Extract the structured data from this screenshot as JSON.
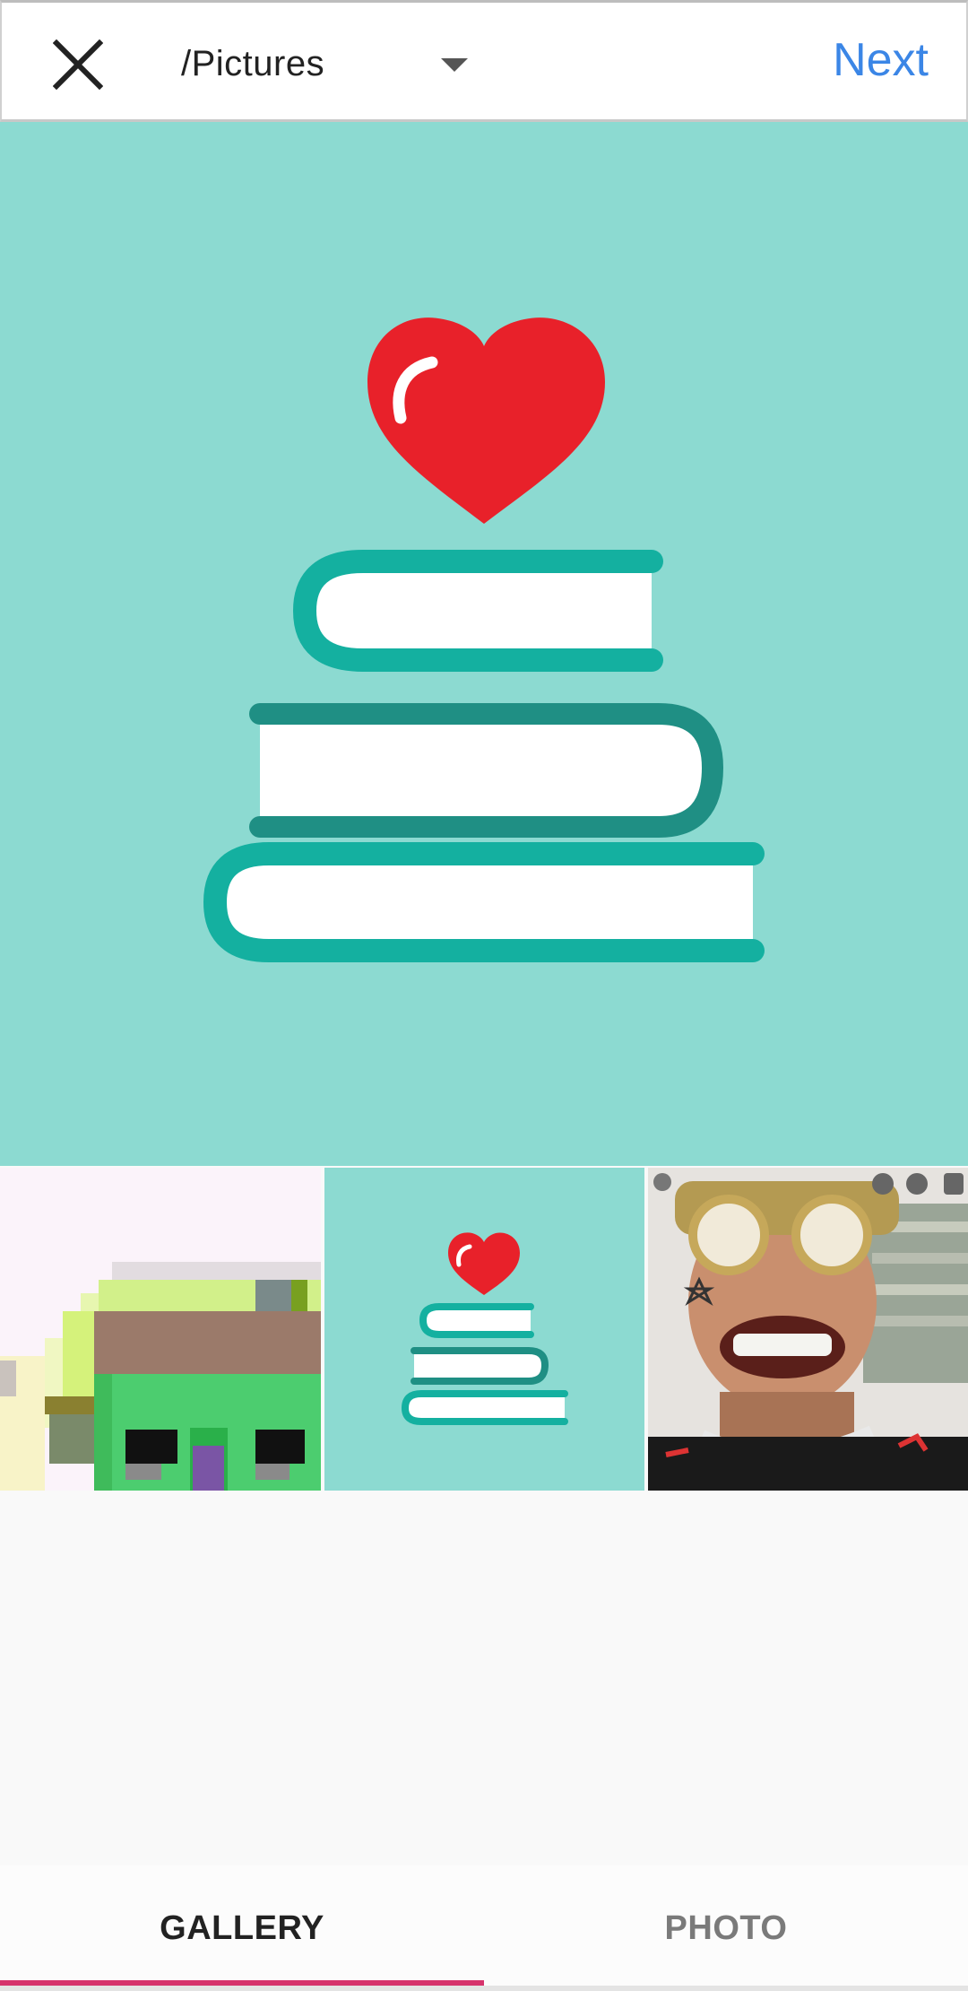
{
  "header": {
    "folder": "/Pictures",
    "next_label": "Next"
  },
  "icons": {
    "close": "close-icon",
    "dropdown": "caret-down-icon",
    "preview": "heart-books-illustration"
  },
  "thumbnails": [
    {
      "name": "pixel-art-thumbnail"
    },
    {
      "name": "heart-books-thumbnail"
    },
    {
      "name": "person-photo-thumbnail"
    }
  ],
  "tabs": [
    {
      "label": "GALLERY",
      "selected": true
    },
    {
      "label": "PHOTO",
      "selected": false
    }
  ],
  "colors": {
    "accent": "#3b86e6",
    "tab_indicator": "#d6336c",
    "preview_background": "#8cdad1",
    "heart": "#e8212a",
    "book_teal": "#14b0a0"
  }
}
